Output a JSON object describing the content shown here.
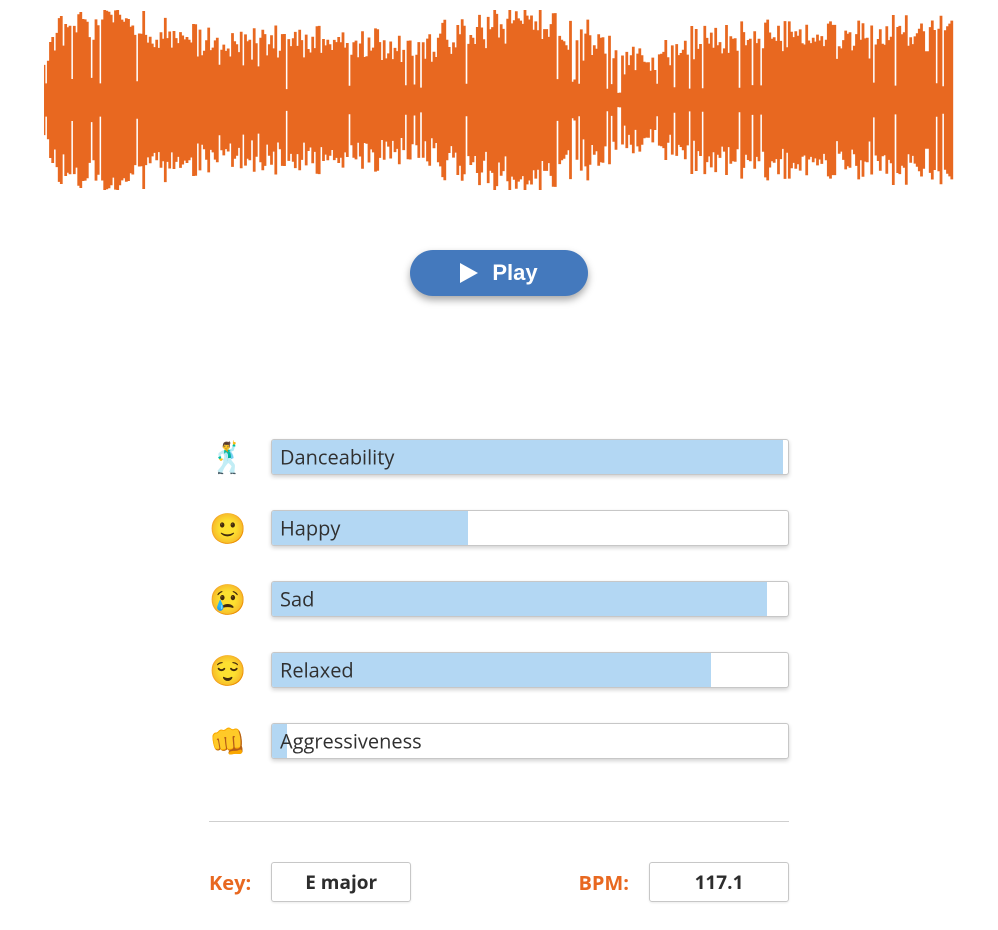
{
  "play": {
    "label": "Play"
  },
  "metrics": [
    {
      "emoji": "🕺",
      "label": "Danceability",
      "value": 99
    },
    {
      "emoji": "🙂",
      "label": "Happy",
      "value": 38
    },
    {
      "emoji": "😢",
      "label": "Sad",
      "value": 96
    },
    {
      "emoji": "😌",
      "label": "Relaxed",
      "value": 85
    },
    {
      "emoji": "👊",
      "label": "Aggressiveness",
      "value": 3
    }
  ],
  "info": {
    "key_label": "Key:",
    "key_value": "E major",
    "bpm_label": "BPM:",
    "bpm_value": "117.1"
  },
  "colors": {
    "accent": "#e86820",
    "button": "#4479bd",
    "bar_fill": "#b3d7f3"
  }
}
